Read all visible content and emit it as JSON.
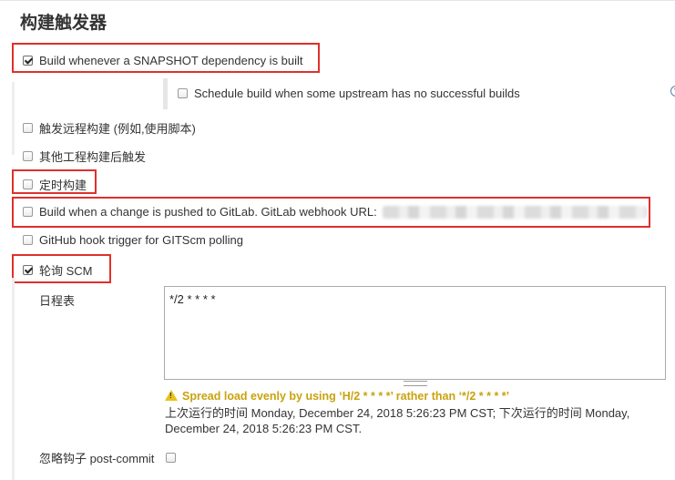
{
  "section_title": "构建触发器",
  "triggers": {
    "snapshot": {
      "label": "Build whenever a SNAPSHOT dependency is built",
      "checked": true
    },
    "upstream_schedule": {
      "label": "Schedule build when some upstream has no successful builds",
      "checked": false
    },
    "remote": {
      "label": "触发远程构建 (例如,使用脚本)",
      "checked": false
    },
    "after_other": {
      "label": "其他工程构建后触发",
      "checked": false
    },
    "timed": {
      "label": "定时构建",
      "checked": false
    },
    "gitlab": {
      "label": "Build when a change is pushed to GitLab. GitLab webhook URL:",
      "checked": false
    },
    "github": {
      "label": "GitHub hook trigger for GITScm polling",
      "checked": false
    },
    "poll_scm": {
      "label": "轮询 SCM",
      "checked": true
    }
  },
  "schedule": {
    "label": "日程表",
    "value": "*/2 * * * *",
    "warning": "Spread load evenly by using ‘H/2 * * * *’ rather than ‘*/2 * * * *’",
    "info": "上次运行的时间 Monday, December 24, 2018 5:26:23 PM CST; 下次运行的时间 Monday, December 24, 2018 5:26:23 PM CST."
  },
  "ignore_post_commit": {
    "label": "忽略钩子 post-commit",
    "checked": false
  },
  "help_icon": "help-icon",
  "accent_red": "#e0302c",
  "warning_color": "#c9a20d"
}
